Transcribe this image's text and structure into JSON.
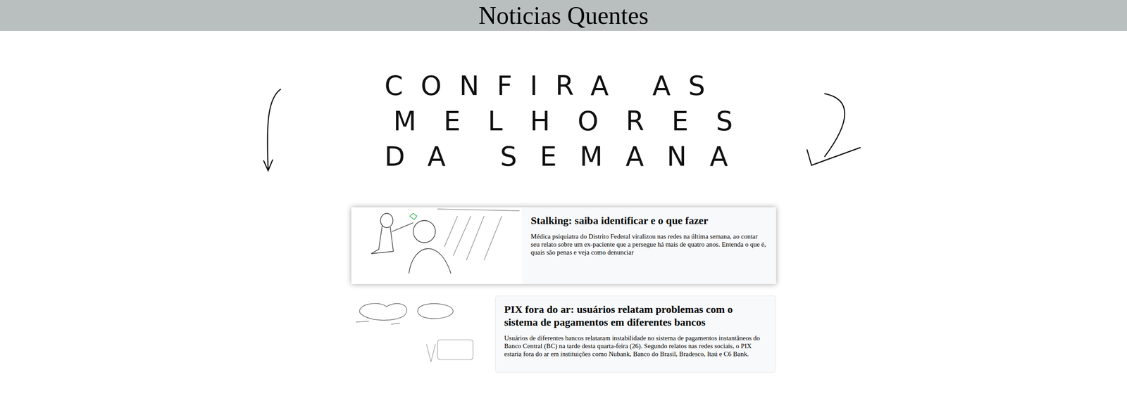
{
  "header": {
    "title": "Noticias Quentes"
  },
  "banner": {
    "lines": [
      "CONFIRA AS",
      "MELHORES",
      "DA SEMANA"
    ]
  },
  "articles": [
    {
      "kind": "featured",
      "title": "Stalking: saiba identificar e o que fazer",
      "body": "Médica psiquiatra do Distrito Federal viralizou nas redes na última semana, ao contar seu relato sobre um ex-paciente que a persegue há mais de quatro anos. Entenda o que é, quais são penas e veja como denunciar"
    },
    {
      "kind": "plain",
      "title": "PIX fora do ar: usuários relatam problemas com o sistema de pagamentos em diferentes bancos",
      "body": "Usuários de diferentes bancos relataram instabilidade no sistema de pagamentos instantâneos do Banco Central (BC) na tarde desta quarta-feira (26). Segundo relatos nas redes sociais, o PIX estaria fora do ar em instituições como Nubank, Banco do Brasil, Bradesco, Itaú e C6 Bank."
    }
  ]
}
